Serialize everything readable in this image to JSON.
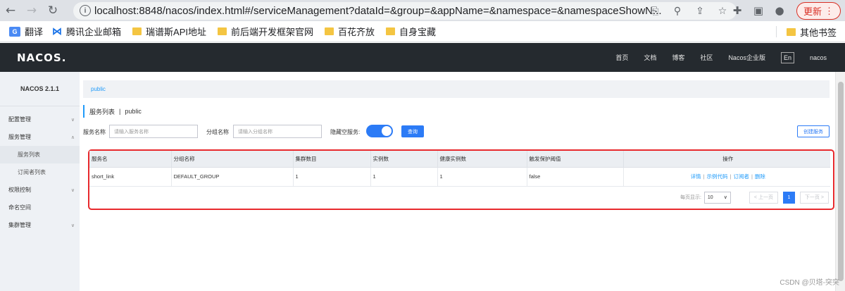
{
  "browser": {
    "url": "localhost:8848/nacos/index.html#/serviceManagement?dataId=&group=&appName=&namespace=&namespaceShowN...",
    "update_label": "更新",
    "bookmarks": [
      {
        "label": "翻译",
        "icon": "translate-icon"
      },
      {
        "label": "腾讯企业邮箱",
        "icon": "tencent-mail-icon"
      },
      {
        "label": "瑞谱斯API地址",
        "icon": "folder-icon"
      },
      {
        "label": "前后端开发框架官网",
        "icon": "folder-icon"
      },
      {
        "label": "百花齐放",
        "icon": "folder-icon"
      },
      {
        "label": "自身宝藏",
        "icon": "folder-icon"
      }
    ],
    "other_bookmarks": "其他书签"
  },
  "header": {
    "logo": "NACOS.",
    "nav": [
      "首页",
      "文档",
      "博客",
      "社区",
      "Nacos企业版"
    ],
    "lang": "En",
    "user": "nacos"
  },
  "sidebar": {
    "version": "NACOS 2.1.1",
    "items": [
      {
        "label": "配置管理",
        "chevron": "∨"
      },
      {
        "label": "服务管理",
        "chevron": "∧"
      },
      {
        "label": "服务列表"
      },
      {
        "label": "订阅者列表"
      },
      {
        "label": "权限控制",
        "chevron": "∨"
      },
      {
        "label": "命名空间"
      },
      {
        "label": "集群管理",
        "chevron": "∨"
      }
    ]
  },
  "main": {
    "breadcrumb": "public",
    "title": "服务列表",
    "title_sep": "|",
    "title_namespace": "public",
    "filter": {
      "service_label": "服务名称",
      "service_placeholder": "请输入服务名称",
      "group_label": "分组名称",
      "group_placeholder": "请输入分组名称",
      "hide_empty_label": "隐藏空服务:",
      "hide_empty_on": true,
      "query_label": "查询",
      "create_label": "创建服务"
    },
    "table": {
      "headers": [
        "服务名",
        "分组名称",
        "集群数目",
        "实例数",
        "健康实例数",
        "触发保护阈值",
        "操作"
      ],
      "rows": [
        {
          "cells": [
            "short_link",
            "DEFAULT_GROUP",
            "1",
            "1",
            "1",
            "false"
          ],
          "actions": [
            "详情",
            "示例代码",
            "订阅者",
            "删除"
          ]
        }
      ]
    },
    "pager": {
      "per_page_label": "每页显示:",
      "per_page": "10",
      "prev": "< 上一页",
      "current": "1",
      "next": "下一页 >"
    }
  },
  "watermark": "CSDN @贝塔-突突",
  "colors": {
    "accent": "#2c7bf6",
    "highlight_border": "#e8292d",
    "header_bg": "#252a2f"
  }
}
